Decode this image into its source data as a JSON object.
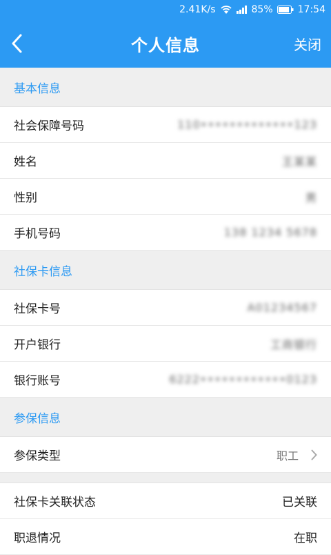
{
  "status_bar": {
    "speed": "2.41K/s",
    "battery": "85%",
    "time": "17:54"
  },
  "header": {
    "title": "个人信息",
    "close_label": "关闭"
  },
  "sections": [
    {
      "title": "基本信息",
      "rows": [
        {
          "label": "社会保障号码",
          "value": "110•••••••••••••123"
        },
        {
          "label": "姓名",
          "value": "王某某"
        },
        {
          "label": "性别",
          "value": "男"
        },
        {
          "label": "手机号码",
          "value": "138 1234 5678"
        }
      ]
    },
    {
      "title": "社保卡信息",
      "rows": [
        {
          "label": "社保卡号",
          "value": "A01234567"
        },
        {
          "label": "开户银行",
          "value": "工商银行"
        },
        {
          "label": "银行账号",
          "value": "6222••••••••••••0123"
        }
      ]
    },
    {
      "title": "参保信息",
      "rows": [
        {
          "label": "参保类型",
          "value": "职工"
        }
      ]
    }
  ],
  "status_rows": [
    {
      "label": "社保卡关联状态",
      "value": "已关联"
    },
    {
      "label": "职退情况",
      "value": "在职"
    }
  ]
}
